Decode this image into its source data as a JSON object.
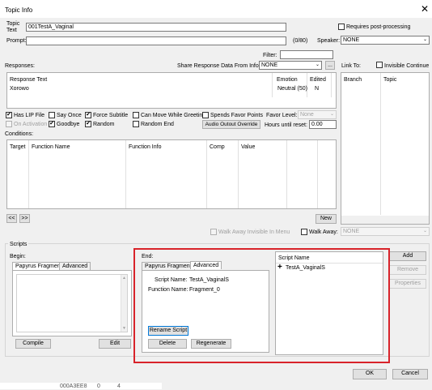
{
  "window": {
    "title": "Topic Info"
  },
  "topic_text": {
    "label": "Topic Text",
    "value": "001TestA_Vaginal"
  },
  "requires_post_processing": {
    "label": "Requires post-processing"
  },
  "prompt": {
    "label": "Prompt:",
    "value": "",
    "counter": "(0/80)"
  },
  "speaker": {
    "label": "Speaker:",
    "value": "NONE"
  },
  "filter": {
    "label": "Filter:",
    "value": ""
  },
  "responses": {
    "label": "Responses:",
    "share_label": "Share Response Data From Info:",
    "share_value": "NONE",
    "ellipsis_button": "...",
    "columns": [
      "Response Text",
      "Emotion",
      "Edited"
    ],
    "rows": [
      {
        "text": "Xorowo",
        "emotion": "Neutral (50)",
        "edited": "N"
      }
    ]
  },
  "link_to": {
    "label": "Link To:",
    "invisible_continue": "Invisible Continue",
    "columns": [
      "Branch",
      "Topic"
    ]
  },
  "flags": {
    "has_lip_file": "Has LIP File",
    "say_once": "Say Once",
    "force_subtitle": "Force Subtitle",
    "can_move_while_greeting": "Can Move While Greeting",
    "spends_favor_points": "Spends Favor Points",
    "favor_level_label": "Favor Level:",
    "favor_level_value": "None",
    "on_activation": "On Activation",
    "goodbye": "Goodbye",
    "random": "Random",
    "random_end": "Random End",
    "audio_output_override": "Audio Outout Override",
    "hours_until_reset_label": "Hours until reset:",
    "hours_until_reset_value": "0.00"
  },
  "conditions": {
    "label": "Conditions:",
    "columns": [
      "Target",
      "Function Name",
      "Function Info",
      "Comp",
      "Value"
    ],
    "prev_button": "<<",
    "next_button": ">>",
    "new_button": "New"
  },
  "walk_away_invisible": "Walk Away Invisible In Menu",
  "walk_away": {
    "label": "Walk Away:",
    "value": "NONE"
  },
  "scripts": {
    "label": "Scripts",
    "begin": {
      "label": "Begin:",
      "tabs": [
        "Papyrus Fragment",
        "Advanced"
      ],
      "compile_button": "Compile",
      "edit_button": "Edit"
    },
    "end": {
      "label": "End:",
      "tabs": [
        "Papyrus Fragment",
        "Advanced"
      ],
      "script_name_label": "Script Name:",
      "script_name_value": "TestA_VaginalS",
      "function_name_label": "Function Name:",
      "function_name_value": "Fragment_0",
      "rename_button": "Rename Script",
      "delete_button": "Delete",
      "regenerate_button": "Regenerate"
    },
    "list": {
      "header": "Script Name",
      "items": [
        "TestA_VaginalS"
      ]
    },
    "add_button": "Add",
    "remove_button": "Remove",
    "properties_button": "Properties"
  },
  "ok_button": "OK",
  "cancel_button": "Cancel",
  "background_row": {
    "id": "000A3EE8",
    "c1": "0",
    "c2": "4"
  },
  "colors": {
    "highlight": "#d8232a",
    "accent": "#0078d7"
  },
  "icons": {
    "close": "close-icon",
    "plus": "plus-icon",
    "dropdown": "chevron-down-icon"
  }
}
